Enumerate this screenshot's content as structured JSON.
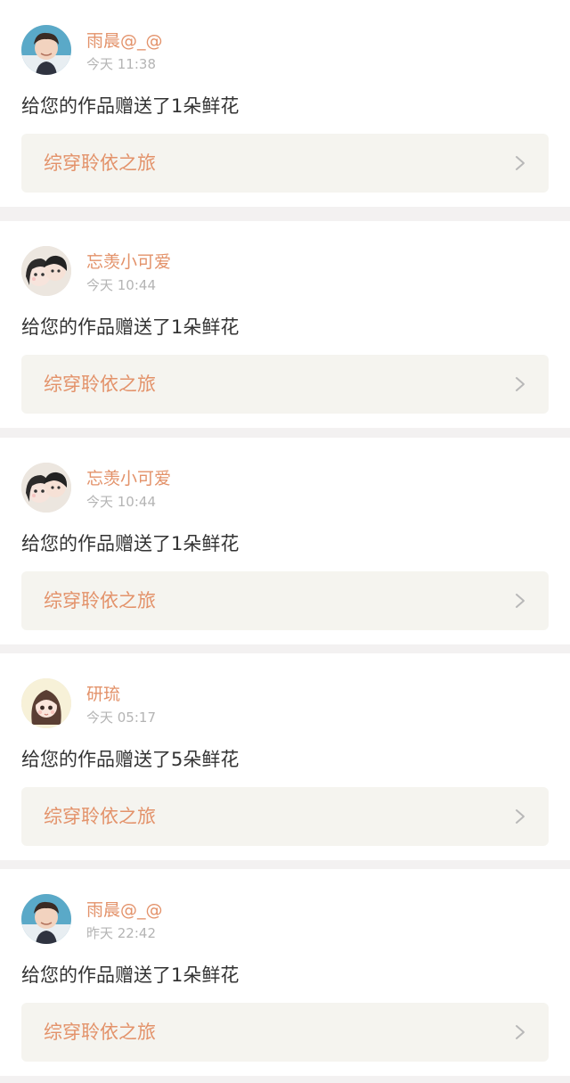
{
  "notifications": [
    {
      "avatar": "young-man-photo-avatar",
      "username": "雨晨@_@",
      "time": "今天 11:38",
      "message": "给您的作品赠送了1朵鲜花",
      "book_title": "综穿聆依之旅"
    },
    {
      "avatar": "cartoon-couple-avatar",
      "username": "忘羡小可爱",
      "time": "今天 10:44",
      "message": "给您的作品赠送了1朵鲜花",
      "book_title": "综穿聆依之旅"
    },
    {
      "avatar": "cartoon-couple-avatar",
      "username": "忘羡小可爱",
      "time": "今天 10:44",
      "message": "给您的作品赠送了1朵鲜花",
      "book_title": "综穿聆依之旅"
    },
    {
      "avatar": "cartoon-girl-avatar",
      "username": "研琉",
      "time": "今天 05:17",
      "message": "给您的作品赠送了5朵鲜花",
      "book_title": "综穿聆依之旅"
    },
    {
      "avatar": "young-man-photo-avatar",
      "username": "雨晨@_@",
      "time": "昨天 22:42",
      "message": "给您的作品赠送了1朵鲜花",
      "book_title": "综穿聆依之旅"
    }
  ],
  "colors": {
    "accent": "#e3926a",
    "timestamp": "#b4b4b4",
    "message": "#333333",
    "book_bg": "#f5f4ef",
    "page_bg": "#f3f1f1"
  }
}
